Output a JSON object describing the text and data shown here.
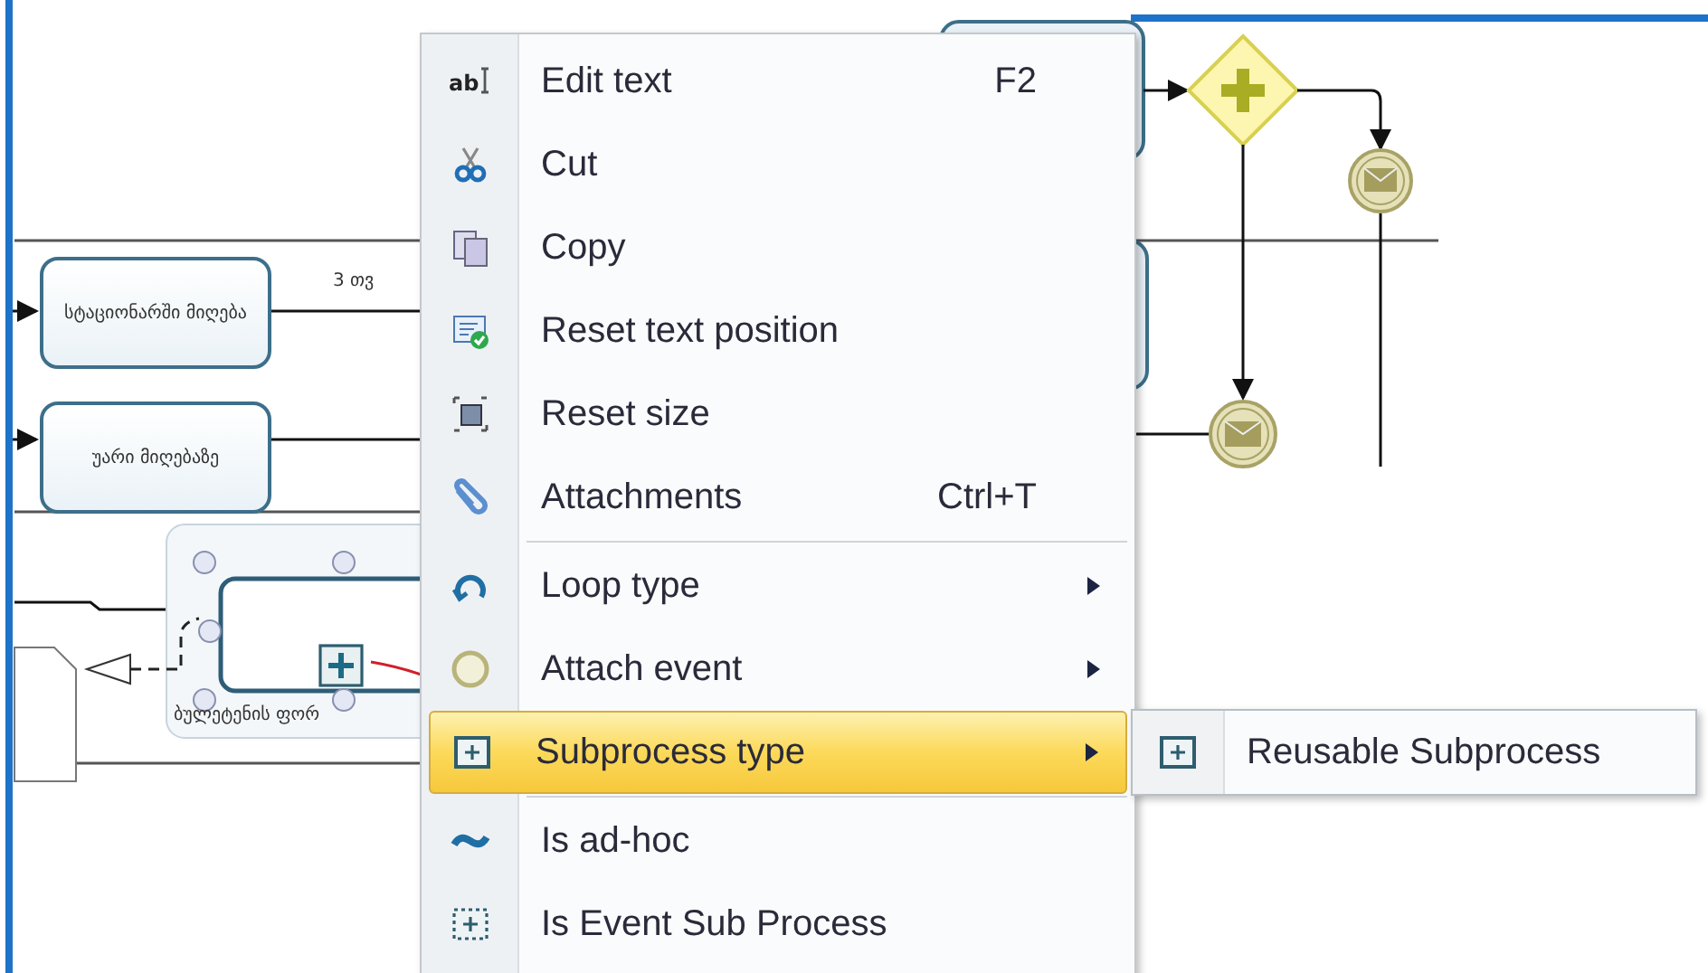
{
  "diagram": {
    "tasks": [
      {
        "label": "სტაციონარში მიღება"
      },
      {
        "label": "უარი მიღებაზე"
      }
    ],
    "flow_label": "3 თვ",
    "subprocess_label": "ბულეტენის ფორ"
  },
  "context_menu": {
    "groups": [
      [
        {
          "kind": "command",
          "label": "Edit text",
          "shortcut": "F2",
          "icon_text": "ab",
          "selected": false
        },
        {
          "kind": "command",
          "label": "Cut",
          "selected": false
        },
        {
          "kind": "command",
          "label": "Copy",
          "selected": false
        },
        {
          "kind": "command",
          "label": "Reset text position",
          "selected": false
        },
        {
          "kind": "command",
          "label": "Reset size",
          "selected": false
        },
        {
          "kind": "command",
          "label": "Attachments",
          "shortcut": "Ctrl+T",
          "selected": false
        }
      ],
      [
        {
          "kind": "submenu",
          "label": "Loop type",
          "selected": false
        },
        {
          "kind": "submenu",
          "label": "Attach event",
          "selected": false
        },
        {
          "kind": "submenu",
          "label": "Subprocess type",
          "selected": true
        }
      ],
      [
        {
          "kind": "command",
          "label": "Is ad-hoc",
          "selected": false
        },
        {
          "kind": "command",
          "label": "Is Event Sub Process",
          "selected": false
        }
      ]
    ]
  },
  "submenu": {
    "items": [
      {
        "label": "Reusable Subprocess"
      }
    ]
  }
}
